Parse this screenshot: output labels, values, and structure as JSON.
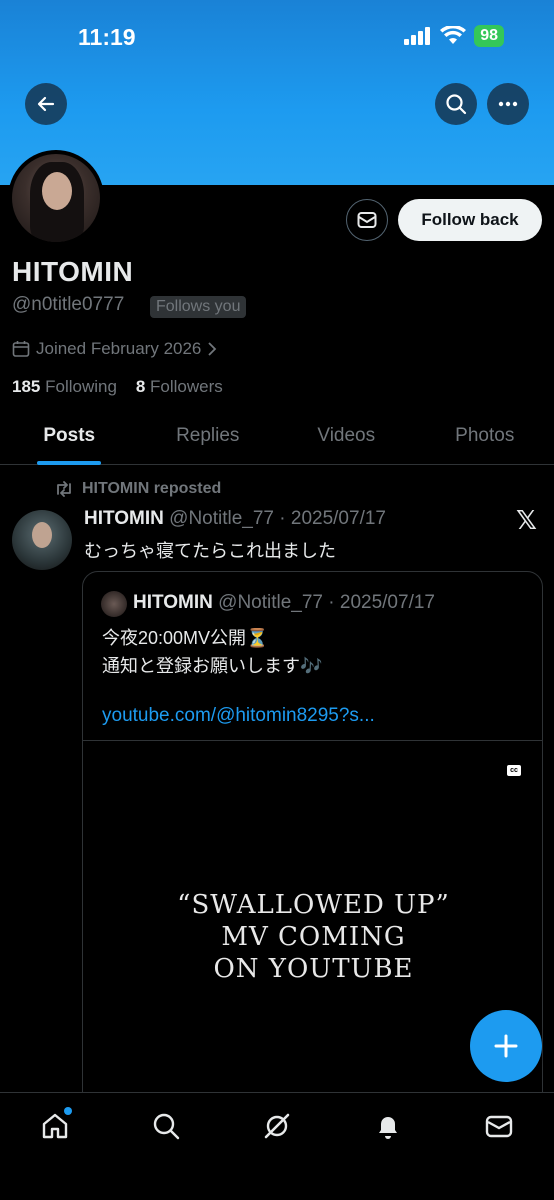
{
  "status_bar": {
    "time": "11:19",
    "battery": "98"
  },
  "profile": {
    "display_name": "HITOMIN",
    "handle": "@n0title0777",
    "follows_you": "Follows you",
    "joined": "Joined February 2026",
    "following_count": "185",
    "following_label": "Following",
    "followers_count": "8",
    "followers_label": "Followers",
    "follow_back_label": "Follow back"
  },
  "tabs": [
    {
      "label": "Posts",
      "active": true
    },
    {
      "label": "Replies",
      "active": false
    },
    {
      "label": "Videos",
      "active": false
    },
    {
      "label": "Photos",
      "active": false
    }
  ],
  "post": {
    "repost_label": "HITOMIN reposted",
    "author": "HITOMIN",
    "author_handle": "@Notitle_77",
    "date": "· 2025/07/17",
    "text": "むっちゃ寝てたらこれ出ました",
    "quote": {
      "author": "HITOMIN",
      "author_handle": "@Notitle_77",
      "date": "· 2025/07/17",
      "line1": "今夜20:00MV公開⏳",
      "line2": "通知と登録お願いします🎶",
      "link": "youtube.com/@hitomin8295?s...",
      "media_caption_line1": "“SWALLOWED UP”",
      "media_caption_line2": "MV COMING",
      "media_caption_line3": "ON YOUTUBE",
      "cc_label": "cc"
    }
  },
  "colors": {
    "accent": "#1d9bf0",
    "banner": "#1d9bf0",
    "background": "#000000"
  },
  "icons": [
    "back-arrow-icon",
    "search-icon",
    "more-icon",
    "mail-icon",
    "calendar-icon",
    "chevron-right-icon",
    "repost-icon",
    "x-logo-icon",
    "plus-icon",
    "home-icon",
    "explore-icon",
    "grok-icon",
    "bell-icon",
    "messages-icon"
  ]
}
